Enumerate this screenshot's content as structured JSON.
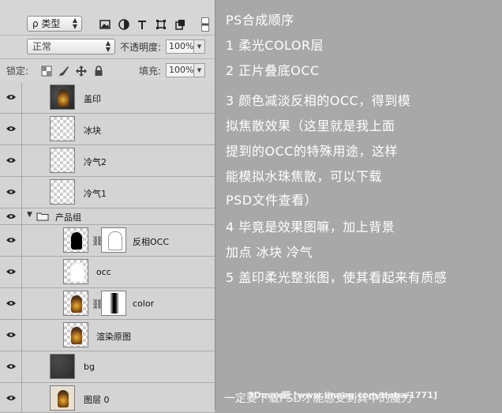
{
  "toolbar": {
    "filter_kind": "ρ 类型",
    "blend_mode": "正常",
    "opacity_label": "不透明度:",
    "opacity_value": "100%",
    "lock_label": "锁定:",
    "fill_label": "填充:",
    "fill_value": "100%"
  },
  "layers": [
    {
      "name": "盖印"
    },
    {
      "name": "冰块"
    },
    {
      "name": "冷气2"
    },
    {
      "name": "冷气1"
    },
    {
      "name": "产品组"
    },
    {
      "name": "反相OCC"
    },
    {
      "name": "occ"
    },
    {
      "name": "color"
    },
    {
      "name": "渲染原图"
    },
    {
      "name": "bg"
    },
    {
      "name": "图层 0"
    }
  ],
  "notes": [
    "PS合成顺序",
    "1 柔光COLOR层",
    "2 正片叠底OCC",
    "3 颜色减淡反相的OCC，得到模",
    "拟焦散效果（这里就是我上面",
    "提到的OCC的特殊用途，这样",
    "能模拟水珠焦散，可以下载",
    "PSD文件查看）",
    "4 毕竟是效果图嘛，加上背景",
    "加点 冰块 冷气",
    "5 盖印柔光整张图，使其看起来有质感"
  ],
  "watermark": "一定要下载PSD才能感受到其中的魔力",
  "watermark_overlay": "3Dmax吧  [www.lineeg.com/tieba/1771]"
}
